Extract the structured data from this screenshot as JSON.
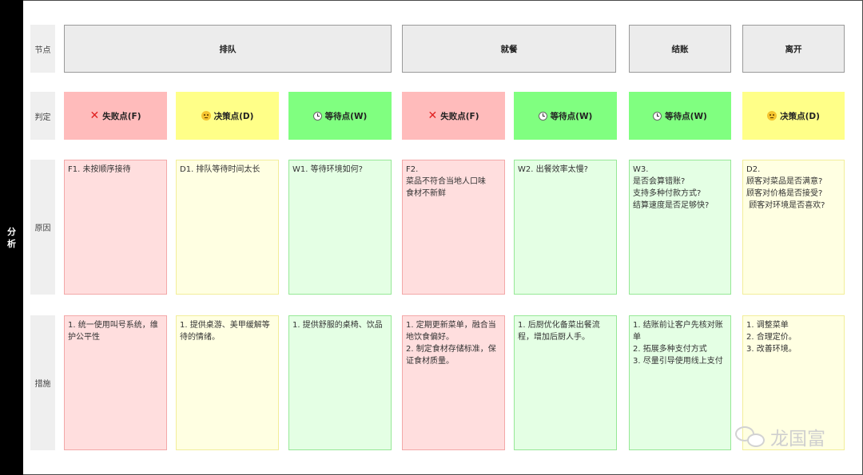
{
  "side_label": "分析",
  "row_labels": {
    "node": "节点",
    "judge": "判定",
    "cause": "原因",
    "measure": "措施"
  },
  "stages": [
    "排队",
    "就餐",
    "结账",
    "离开"
  ],
  "judgements": [
    {
      "type": "fail",
      "icon": "cross-icon",
      "label": "失败点(F)"
    },
    {
      "type": "decide",
      "icon": "thinking-face-icon",
      "label": "决策点(D)"
    },
    {
      "type": "wait",
      "icon": "clock-icon",
      "label": "等待点(W)"
    },
    {
      "type": "fail",
      "icon": "cross-icon",
      "label": "失败点(F)"
    },
    {
      "type": "wait",
      "icon": "clock-icon",
      "label": "等待点(W)"
    },
    {
      "type": "wait",
      "icon": "clock-icon",
      "label": "等待点(W)"
    },
    {
      "type": "decide",
      "icon": "thinking-face-icon",
      "label": "决策点(D)"
    }
  ],
  "causes": [
    "F1. 未按顺序接待",
    "D1. 排队等待时间太长",
    "W1. 等待环境如何?",
    "F2.\n菜品不符合当地人口味\n食材不新鲜",
    "W2. 出餐效率太慢?",
    "W3.\n是否会算错账?\n支持多种付款方式?\n结算速度是否足够快?",
    "D2.\n顾客对菜品是否满意?\n顾客对价格是否接受?\n 顾客对环境是否喜欢?"
  ],
  "measures": [
    "1. 统一使用叫号系统，维\n护公平性",
    "1. 提供桌游、美甲缓解等\n待的情绪。",
    "1. 提供舒服的桌椅、饮品",
    "1. 定期更新菜单，融合当\n地饮食偏好。\n2. 制定食材存储标准，保\n证食材质量。",
    "1. 后厨优化备菜出餐流\n程，增加后厨人手。",
    "1. 结账前让客户先核对账\n单\n2. 拓展多种支付方式\n3. 尽量引导使用线上支付",
    "1. 调整菜单\n2. 合理定价。\n3. 改善环境。"
  ],
  "watermark": "龙国富",
  "colors": {
    "fail_header": "#ffbbbb",
    "decide_header": "#ffff88",
    "wait_header": "#80ff80",
    "fail_cell": "#ffdede",
    "decide_cell": "#ffffe2",
    "wait_cell": "#e4ffe4",
    "stage_header": "#ececec",
    "side_bar": "#000000"
  }
}
